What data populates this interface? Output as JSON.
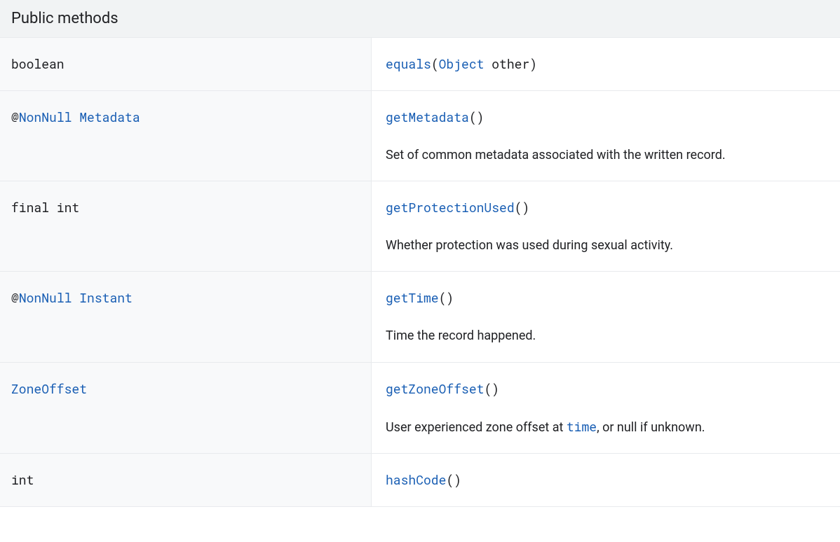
{
  "header": "Public methods",
  "rows": [
    {
      "returnType": [
        {
          "text": "boolean",
          "link": false
        }
      ],
      "signature": [
        {
          "text": "equals",
          "link": true
        },
        {
          "text": "(",
          "link": false
        },
        {
          "text": "Object",
          "link": true
        },
        {
          "text": " other)",
          "link": false
        }
      ],
      "description": null
    },
    {
      "returnType": [
        {
          "text": "@",
          "link": false
        },
        {
          "text": "NonNull",
          "link": true
        },
        {
          "text": " ",
          "link": false
        },
        {
          "text": "Metadata",
          "link": true
        }
      ],
      "signature": [
        {
          "text": "getMetadata",
          "link": true
        },
        {
          "text": "()",
          "link": false
        }
      ],
      "description": [
        {
          "text": "Set of common metadata associated with the written record.",
          "link": false
        }
      ]
    },
    {
      "returnType": [
        {
          "text": "final int",
          "link": false
        }
      ],
      "signature": [
        {
          "text": "getProtectionUsed",
          "link": true
        },
        {
          "text": "()",
          "link": false
        }
      ],
      "description": [
        {
          "text": "Whether protection was used during sexual activity.",
          "link": false
        }
      ]
    },
    {
      "returnType": [
        {
          "text": "@",
          "link": false
        },
        {
          "text": "NonNull",
          "link": true
        },
        {
          "text": " ",
          "link": false
        },
        {
          "text": "Instant",
          "link": true
        }
      ],
      "signature": [
        {
          "text": "getTime",
          "link": true
        },
        {
          "text": "()",
          "link": false
        }
      ],
      "description": [
        {
          "text": "Time the record happened.",
          "link": false
        }
      ]
    },
    {
      "returnType": [
        {
          "text": "ZoneOffset",
          "link": true
        }
      ],
      "signature": [
        {
          "text": "getZoneOffset",
          "link": true
        },
        {
          "text": "()",
          "link": false
        }
      ],
      "description": [
        {
          "text": "User experienced zone offset at ",
          "link": false
        },
        {
          "text": "time",
          "link": true,
          "mono": true
        },
        {
          "text": ", or null if unknown.",
          "link": false
        }
      ]
    },
    {
      "returnType": [
        {
          "text": "int",
          "link": false
        }
      ],
      "signature": [
        {
          "text": "hashCode",
          "link": true
        },
        {
          "text": "()",
          "link": false
        }
      ],
      "description": null
    }
  ]
}
